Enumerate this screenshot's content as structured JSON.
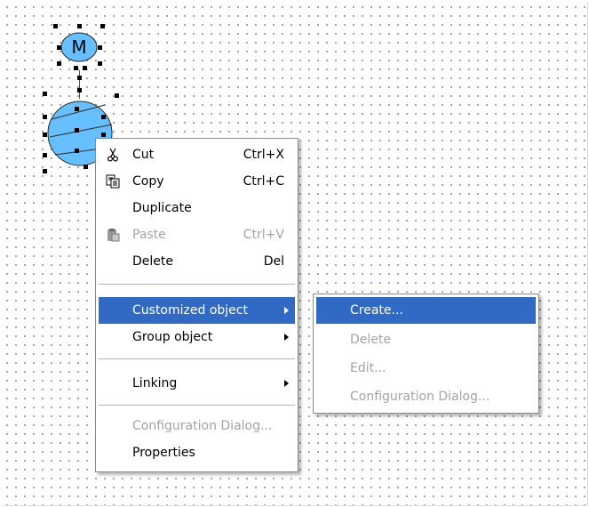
{
  "context_menu": {
    "items": [
      {
        "label": "Cut",
        "shortcut": "Ctrl+X",
        "icon": "scissors-icon",
        "enabled": true
      },
      {
        "label": "Copy",
        "shortcut": "Ctrl+C",
        "icon": "copy-icon",
        "enabled": true
      },
      {
        "label": "Duplicate",
        "shortcut": "",
        "enabled": true
      },
      {
        "label": "Paste",
        "shortcut": "Ctrl+V",
        "icon": "paste-icon",
        "enabled": false
      },
      {
        "label": "Delete",
        "shortcut": "Del",
        "enabled": true
      },
      {
        "label": "Customized object",
        "has_submenu": true,
        "highlighted": true,
        "enabled": true
      },
      {
        "label": "Group object",
        "has_submenu": true,
        "enabled": true
      },
      {
        "label": "Linking",
        "has_submenu": true,
        "enabled": true
      },
      {
        "label": "Configuration Dialog...",
        "enabled": false
      },
      {
        "label": "Properties",
        "enabled": true
      }
    ]
  },
  "submenu": {
    "items": [
      {
        "label": "Create...",
        "highlighted": true,
        "enabled": true
      },
      {
        "label": "Delete",
        "enabled": false
      },
      {
        "label": "Edit...",
        "enabled": false
      },
      {
        "label": "Configuration Dialog...",
        "enabled": false
      }
    ]
  },
  "diagram": {
    "motor_symbol_label": "M"
  },
  "colors": {
    "highlight": "#316ac5",
    "shape_fill": "#66c0ff",
    "disabled_text": "#a3a3a3"
  }
}
